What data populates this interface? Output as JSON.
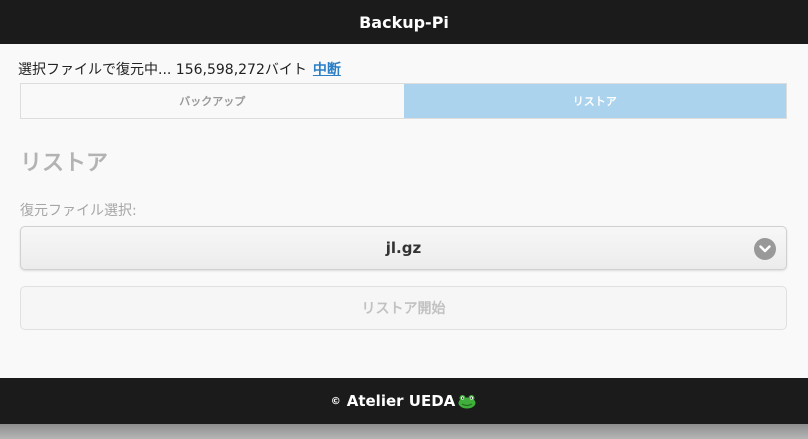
{
  "header": {
    "title": "Backup-Pi"
  },
  "status": {
    "text": "選択ファイルで復元中... 156,598,272バイト",
    "abort_label": "中断"
  },
  "tabs": [
    {
      "label": "バックアップ",
      "active": false
    },
    {
      "label": "リストア",
      "active": true
    }
  ],
  "main": {
    "section_title": "リストア",
    "file_select_label": "復元ファイル選択:",
    "selected_file": "jl.gz",
    "start_button_label": "リストア開始"
  },
  "footer": {
    "copyright_symbol": "©",
    "text": "Atelier UEDA",
    "logo_icon": "frog-icon"
  },
  "colors": {
    "header_bg": "#1b1b1b",
    "active_tab": "#acd3ee",
    "link": "#2a7fc7"
  }
}
